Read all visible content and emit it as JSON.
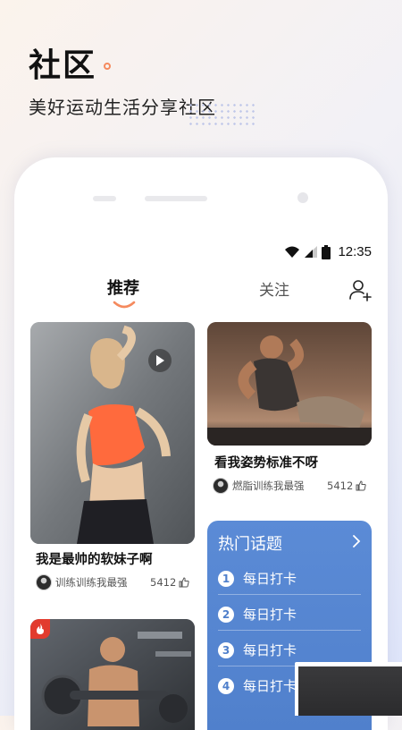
{
  "hero": {
    "title": "社区",
    "subtitle": "美好运动生活分享社区"
  },
  "status": {
    "time": "12:35"
  },
  "tabs": {
    "recommend": "推荐",
    "follow": "关注"
  },
  "posts": [
    {
      "title": "我是最帅的软妹子啊",
      "author": "训练训练我最强",
      "likes": "5412"
    },
    {
      "title": "看我姿势标准不呀",
      "author": "燃脂训练我最强",
      "likes": "5412"
    }
  ],
  "topics": {
    "title": "热门话题",
    "items": [
      {
        "num": "1",
        "label": "每日打卡"
      },
      {
        "num": "2",
        "label": "每日打卡"
      },
      {
        "num": "3",
        "label": "每日打卡"
      },
      {
        "num": "4",
        "label": "每日打卡"
      }
    ]
  },
  "colors": {
    "accent_orange": "#f58a5e",
    "topic_blue": "#4f7fcb",
    "badge_red": "#e23b2e"
  }
}
